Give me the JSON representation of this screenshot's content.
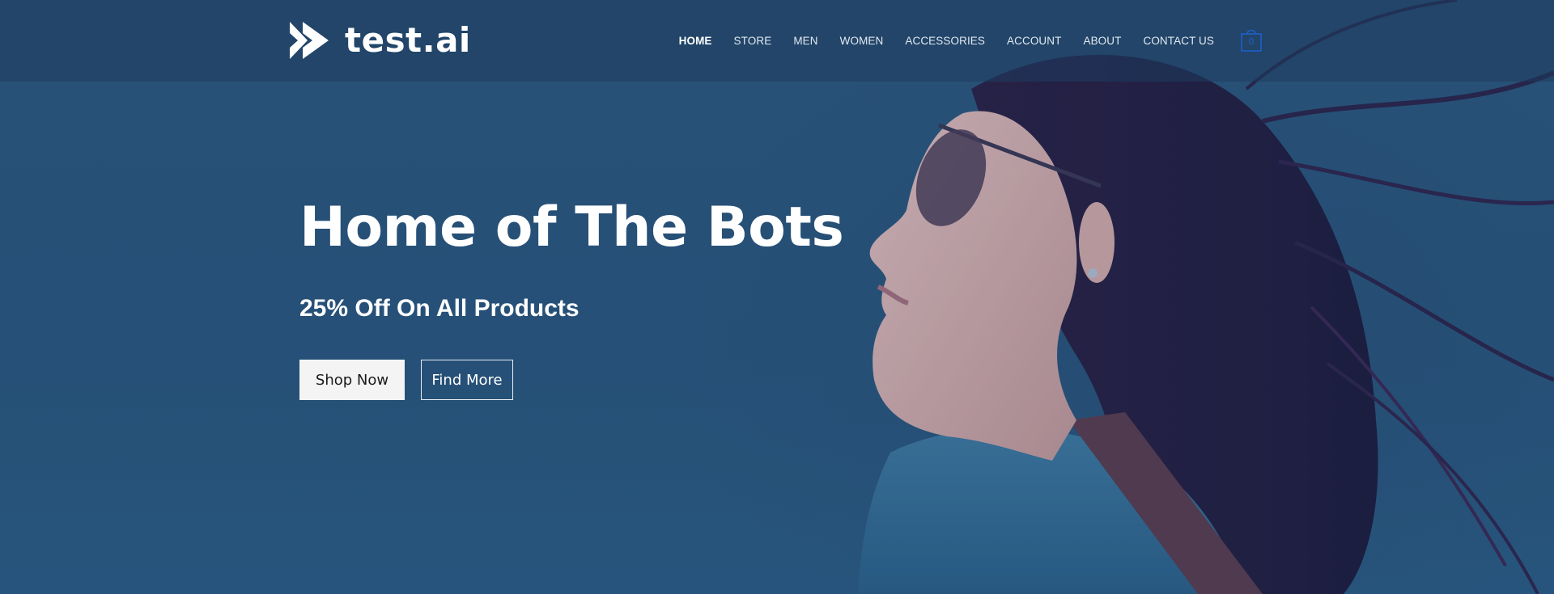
{
  "brand": {
    "logo_icon": "double-chevron-right-icon",
    "name": "test.ai"
  },
  "nav": {
    "items": [
      {
        "label": "HOME",
        "active": true
      },
      {
        "label": "STORE"
      },
      {
        "label": "MEN"
      },
      {
        "label": "WOMEN"
      },
      {
        "label": "ACCESSORIES"
      },
      {
        "label": "ACCOUNT"
      },
      {
        "label": "ABOUT"
      },
      {
        "label": "CONTACT US"
      }
    ]
  },
  "cart": {
    "icon": "shopping-bag-icon",
    "count": "0"
  },
  "hero": {
    "image": "woman-profile-sunglasses-photo",
    "title": "Home of The Bots",
    "subtitle": "25% Off On All Products",
    "primary_button": "Shop Now",
    "secondary_button": "Find More"
  },
  "colors": {
    "background": "#2a5277",
    "header_overlay": "#1e3c5f",
    "text": "#ffffff",
    "primary_button_bg": "#f4f4f4",
    "cart_accent": "#1d5fc7"
  }
}
